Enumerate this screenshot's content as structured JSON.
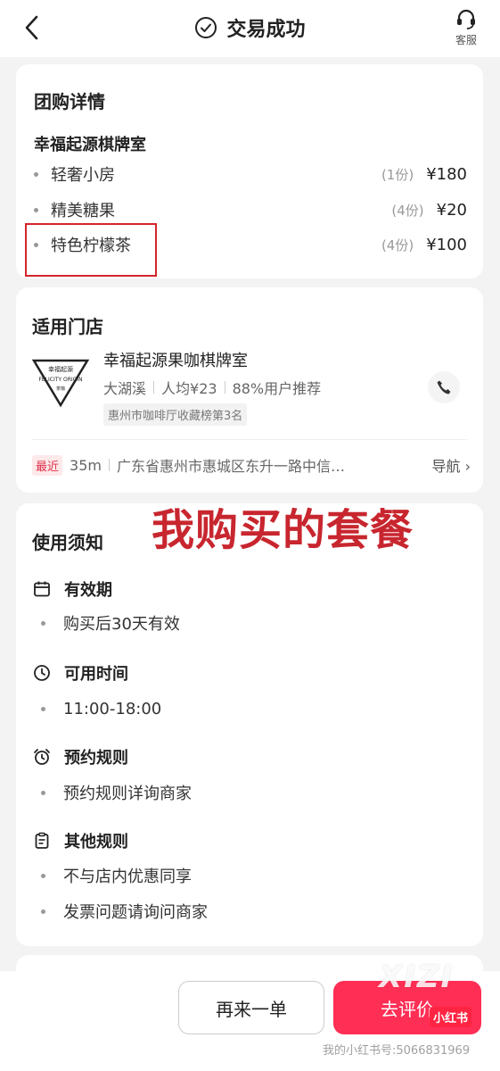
{
  "header": {
    "title": "交易成功",
    "service_label": "客服"
  },
  "group_detail": {
    "title": "团购详情",
    "shop": "幸福起源棋牌室",
    "items": [
      {
        "name": "轻奢小房",
        "qty": "(1份)",
        "price": "¥180"
      },
      {
        "name": "精美糖果",
        "qty": "(4份)",
        "price": "¥20"
      },
      {
        "name": "特色柠檬茶",
        "qty": "(4份)",
        "price": "¥100"
      }
    ]
  },
  "store": {
    "title": "适用门店",
    "name": "幸福起源果咖棋牌室",
    "area": "大湖溪",
    "avg": "人均¥23",
    "recommend": "88%用户推荐",
    "rank": "惠州市咖啡厅收藏榜第3名",
    "logo_top": "幸福起源",
    "logo_mid": "FELICITY ORIGIN",
    "logo_bottom": "茶咖",
    "recent_tag": "最近",
    "distance": "35m",
    "address": "广东省惠州市惠城区东升一路中信…",
    "nav_label": "导航 ›"
  },
  "notice": {
    "title": "使用须知",
    "overlay": "我购买的套餐",
    "sections": [
      {
        "title": "有效期",
        "icon": "calendar-icon",
        "items": [
          "购买后30天有效"
        ]
      },
      {
        "title": "可用时间",
        "icon": "clock-icon",
        "items": [
          "11:00-18:00"
        ]
      },
      {
        "title": "预约规则",
        "icon": "alarm-icon",
        "items": [
          "预约规则详询商家"
        ]
      },
      {
        "title": "其他规则",
        "icon": "clipboard-icon",
        "items": [
          "不与店内优惠同享",
          "发票问题请询问商家"
        ]
      }
    ]
  },
  "actions": {
    "again": "再来一单",
    "review": "去评价"
  },
  "watermark": {
    "site": "XIZI",
    "app": "小红书",
    "id": "我的小红书号:5066831969"
  },
  "colors": {
    "accent": "#ff2e55",
    "highlight": "#d4252a",
    "overlay": "#c8262f"
  }
}
